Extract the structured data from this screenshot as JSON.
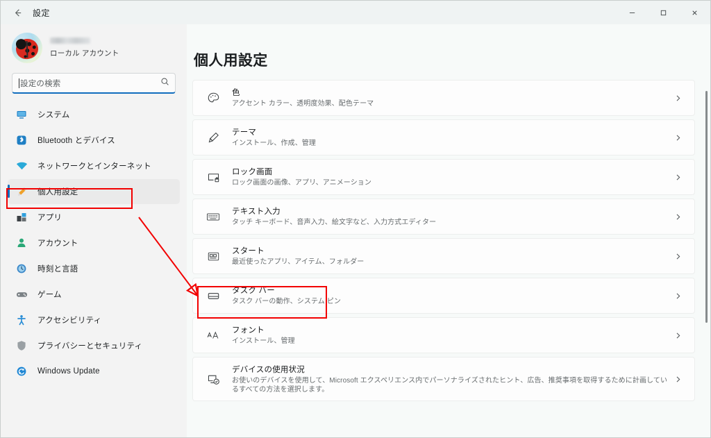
{
  "window": {
    "title": "設定",
    "back_icon": "back-arrow-icon",
    "controls": {
      "minimize": "minimize-icon",
      "maximize": "maximize-icon",
      "close": "close-icon"
    }
  },
  "sidebar": {
    "profile": {
      "user_name": "",
      "account_type": "ローカル アカウント",
      "avatar_icon": "ladybug-avatar"
    },
    "search": {
      "placeholder": "設定の検索",
      "icon": "search-icon"
    },
    "items": [
      {
        "label": "システム",
        "icon": "system-monitor-icon",
        "active": false
      },
      {
        "label": "Bluetooth とデバイス",
        "icon": "bluetooth-icon",
        "active": false
      },
      {
        "label": "ネットワークとインターネット",
        "icon": "wifi-icon",
        "active": false
      },
      {
        "label": "個人用設定",
        "icon": "paintbrush-icon",
        "active": true
      },
      {
        "label": "アプリ",
        "icon": "apps-icon",
        "active": false
      },
      {
        "label": "アカウント",
        "icon": "account-person-icon",
        "active": false
      },
      {
        "label": "時刻と言語",
        "icon": "clock-globe-icon",
        "active": false
      },
      {
        "label": "ゲーム",
        "icon": "gamepad-icon",
        "active": false
      },
      {
        "label": "アクセシビリティ",
        "icon": "accessibility-icon",
        "active": false
      },
      {
        "label": "プライバシーとセキュリティ",
        "icon": "shield-icon",
        "active": false
      },
      {
        "label": "Windows Update",
        "icon": "update-refresh-icon",
        "active": false
      }
    ]
  },
  "main": {
    "page_title": "個人用設定",
    "cards": [
      {
        "title": "色",
        "subtitle": "アクセント カラー、透明度効果、配色テーマ",
        "icon": "palette-icon",
        "chevron": "chevron-right-icon",
        "highlighted": false
      },
      {
        "title": "テーマ",
        "subtitle": "インストール、作成、管理",
        "icon": "paintbrush-icon",
        "chevron": "chevron-right-icon",
        "highlighted": false
      },
      {
        "title": "ロック画面",
        "subtitle": "ロック画面の画像、アプリ、アニメーション",
        "icon": "lock-screen-icon",
        "chevron": "chevron-right-icon",
        "highlighted": false
      },
      {
        "title": "テキスト入力",
        "subtitle": "タッチ キーボード、音声入力、絵文字など、入力方式エディター",
        "icon": "keyboard-icon",
        "chevron": "chevron-right-icon",
        "highlighted": false
      },
      {
        "title": "スタート",
        "subtitle": "最近使ったアプリ、アイテム、フォルダー",
        "icon": "start-menu-icon",
        "chevron": "chevron-right-icon",
        "highlighted": false
      },
      {
        "title": "タスク バー",
        "subtitle": "タスク バーの動作、システム ピン",
        "icon": "taskbar-icon",
        "chevron": "chevron-right-icon",
        "highlighted": true
      },
      {
        "title": "フォント",
        "subtitle": "インストール、管理",
        "icon": "font-aa-icon",
        "chevron": "chevron-right-icon",
        "highlighted": false
      },
      {
        "title": "デバイスの使用状況",
        "subtitle": "お使いのデバイスを使用して、Microsoft エクスペリエンス内でパーソナライズされたヒント、広告、推奨事項を取得するために計画しているすべての方法を選択します。",
        "icon": "device-usage-icon",
        "chevron": "chevron-right-icon",
        "highlighted": false
      }
    ]
  },
  "annotations": {
    "accent_color": "#f20000",
    "selection_accent": "#0f6cbd",
    "sidebar_box_target": "個人用設定",
    "card_box_target": "タスク バー",
    "arrow_icon": "red-pointer-arrow"
  }
}
